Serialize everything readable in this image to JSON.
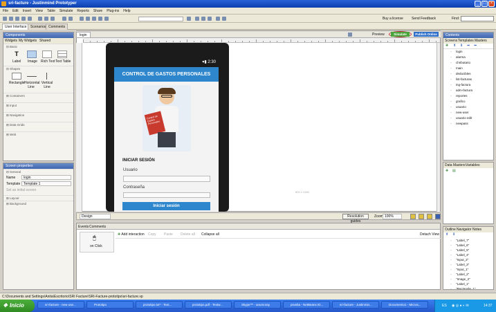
{
  "window": {
    "title": "sri-facture - Justinmind Prototyper"
  },
  "menu": [
    "File",
    "Edit",
    "Insert",
    "View",
    "Table",
    "Simulate",
    "Reports",
    "Share",
    "Plug-ins",
    "Help"
  ],
  "top_tabs": [
    "User Interface",
    "Scenarios",
    "Comments"
  ],
  "toolbar_right": {
    "buy": "Buy a license",
    "feedback": "Send Feedback",
    "find": "Find:"
  },
  "left": {
    "head": "Components",
    "tabs": [
      "Widgets",
      "My Widgets",
      "Shared"
    ],
    "basic": "Basic",
    "widgets_row1": [
      "Label",
      "Image",
      "Rich Text",
      "Text Table"
    ],
    "shapes": "Shapes",
    "widgets_row2": [
      "Rectangle",
      "Horizontal Line",
      "Vertical Line"
    ],
    "sections": [
      "Containers",
      "Input",
      "Navigation",
      "Data Grids",
      "Web"
    ]
  },
  "props": {
    "head": "Screen properties",
    "general": "General",
    "name_label": "Name",
    "name_value": "login",
    "template_label": "Template",
    "template_value": "Template 1",
    "initial": "Set as initial screen",
    "layout": "Layout",
    "background": "Background"
  },
  "canvas": {
    "tab": "login",
    "preview": "Preview",
    "simulate": "Simulate",
    "publish": "Publish Online",
    "size_note": "800 x 1280"
  },
  "phone": {
    "time": "2:30",
    "header": "CONTROL DE GASTOS PERSONALES",
    "card": "Control de Gastos Personales",
    "login_title": "INICIAR SESIÓN",
    "user_label": "Usuario",
    "pass_label": "Contraseña",
    "login_btn": "Iniciar sesión"
  },
  "bottom_bar": {
    "mode": "Design",
    "res": "Resolution guides",
    "zoom_label": "Zoom:",
    "zoom": "100%"
  },
  "events": {
    "tabs": [
      "Events",
      "Comments"
    ],
    "on_click": "on Click",
    "add": "Add interaction",
    "copy": "Copy",
    "paste": "Paste",
    "delete": "Delete all",
    "collapse": "Collapse all",
    "detach": "Detach View"
  },
  "right": {
    "head": "Contents",
    "tabs": [
      "Screens",
      "Templates",
      "Masters"
    ],
    "screens": [
      "login",
      "alarma",
      "chributario",
      "main",
      "deducibles",
      "list-facturas",
      "ing-factura",
      "adm-factura",
      "reportes",
      "grafico",
      "usuario",
      "new-user",
      "usuario edit",
      "newpass"
    ],
    "datamasters_tabs": [
      "Data Masters",
      "Variables"
    ],
    "outline_tabs": [
      "Outline",
      "Navigator",
      "Notes"
    ],
    "outline": [
      "\"Label_7\"",
      "\"Label_6\"",
      "\"Label_5\"",
      "\"Label_4\"",
      "\"Input_2\"",
      "\"Label_3\"",
      "\"Input_1\"",
      "\"Label_2\"",
      "\"Image_2\"",
      "\"Label_1\"",
      "\"Rectangle_1\""
    ]
  },
  "status": {
    "path": "C:\\Documents and Settings\\Anita\\Escritorio\\SRI Facture\\SRI-Facture-prototipo\\sri-facture.vp"
  },
  "taskbar": {
    "start": "Inicio",
    "tasks": [
      "sri-facture - new-use...",
      "Prototipo",
      "prototipo.txt* - Text...",
      "prototipo.pdf - Textw...",
      "Skype™ - anumoray",
      "prueba - NetBeans ID...",
      "sri-facture - Justinmin...",
      "Documento1 - Micros..."
    ],
    "lang": "ES",
    "clock": "14:37"
  },
  "colors": {
    "accent": "#2e86cc",
    "title": "#0c3fae"
  }
}
